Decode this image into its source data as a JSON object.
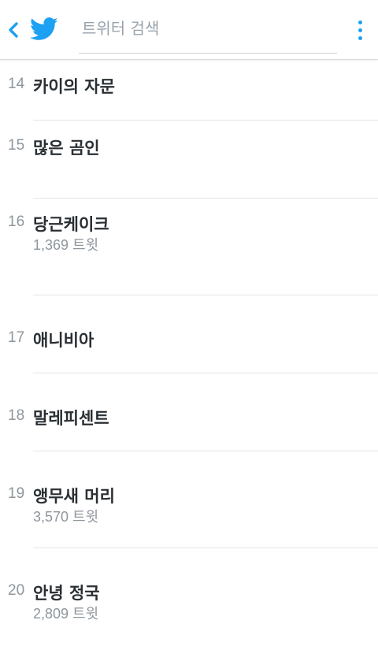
{
  "header": {
    "search_placeholder": "트위터 검색"
  },
  "colors": {
    "accent": "#1da1f2",
    "title_text": "#292f33",
    "muted_text": "#8e969d",
    "divider": "#e1e5e9"
  },
  "icons": {
    "back": "chevron-left-icon",
    "logo": "twitter-bird-icon",
    "menu": "more-vertical-icon"
  },
  "trends": [
    {
      "rank": "14",
      "title": "카이의 자문",
      "count": ""
    },
    {
      "rank": "15",
      "title": "많은 곰인",
      "count": ""
    },
    {
      "rank": "16",
      "title": "당근케이크",
      "count": "1,369 트윗"
    },
    {
      "rank": "17",
      "title": "애니비아",
      "count": ""
    },
    {
      "rank": "18",
      "title": "말레피센트",
      "count": ""
    },
    {
      "rank": "19",
      "title": "앵무새 머리",
      "count": "3,570 트윗"
    },
    {
      "rank": "20",
      "title": "안녕 정국",
      "count": "2,809 트윗"
    }
  ]
}
